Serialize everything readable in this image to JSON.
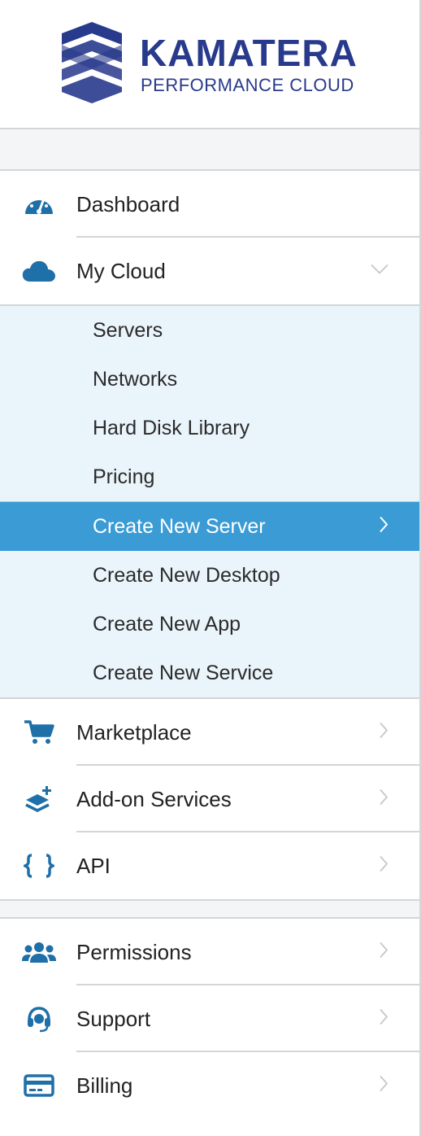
{
  "brand": {
    "name": "KAMATERA",
    "tagline": "PERFORMANCE CLOUD"
  },
  "colors": {
    "brand": "#283a8c",
    "icon": "#1f6fa8",
    "active_bg": "#3a9bd5",
    "submenu_bg": "#eaf4fb"
  },
  "menu": {
    "dashboard": {
      "label": "Dashboard",
      "icon": "dashboard-gauge-icon"
    },
    "my_cloud": {
      "label": "My Cloud",
      "icon": "cloud-icon",
      "expanded": true
    },
    "my_cloud_sub": [
      {
        "label": "Servers"
      },
      {
        "label": "Networks"
      },
      {
        "label": "Hard Disk Library"
      },
      {
        "label": "Pricing"
      },
      {
        "label": "Create New Server",
        "active": true
      },
      {
        "label": "Create New Desktop"
      },
      {
        "label": "Create New App"
      },
      {
        "label": "Create New Service"
      }
    ],
    "marketplace": {
      "label": "Marketplace",
      "icon": "shopping-cart-icon"
    },
    "addon": {
      "label": "Add-on Services",
      "icon": "layers-plus-icon"
    },
    "api": {
      "label": "API",
      "icon": "curly-braces-icon"
    },
    "permissions": {
      "label": "Permissions",
      "icon": "users-group-icon"
    },
    "support": {
      "label": "Support",
      "icon": "headset-icon"
    },
    "billing": {
      "label": "Billing",
      "icon": "credit-card-icon"
    }
  }
}
